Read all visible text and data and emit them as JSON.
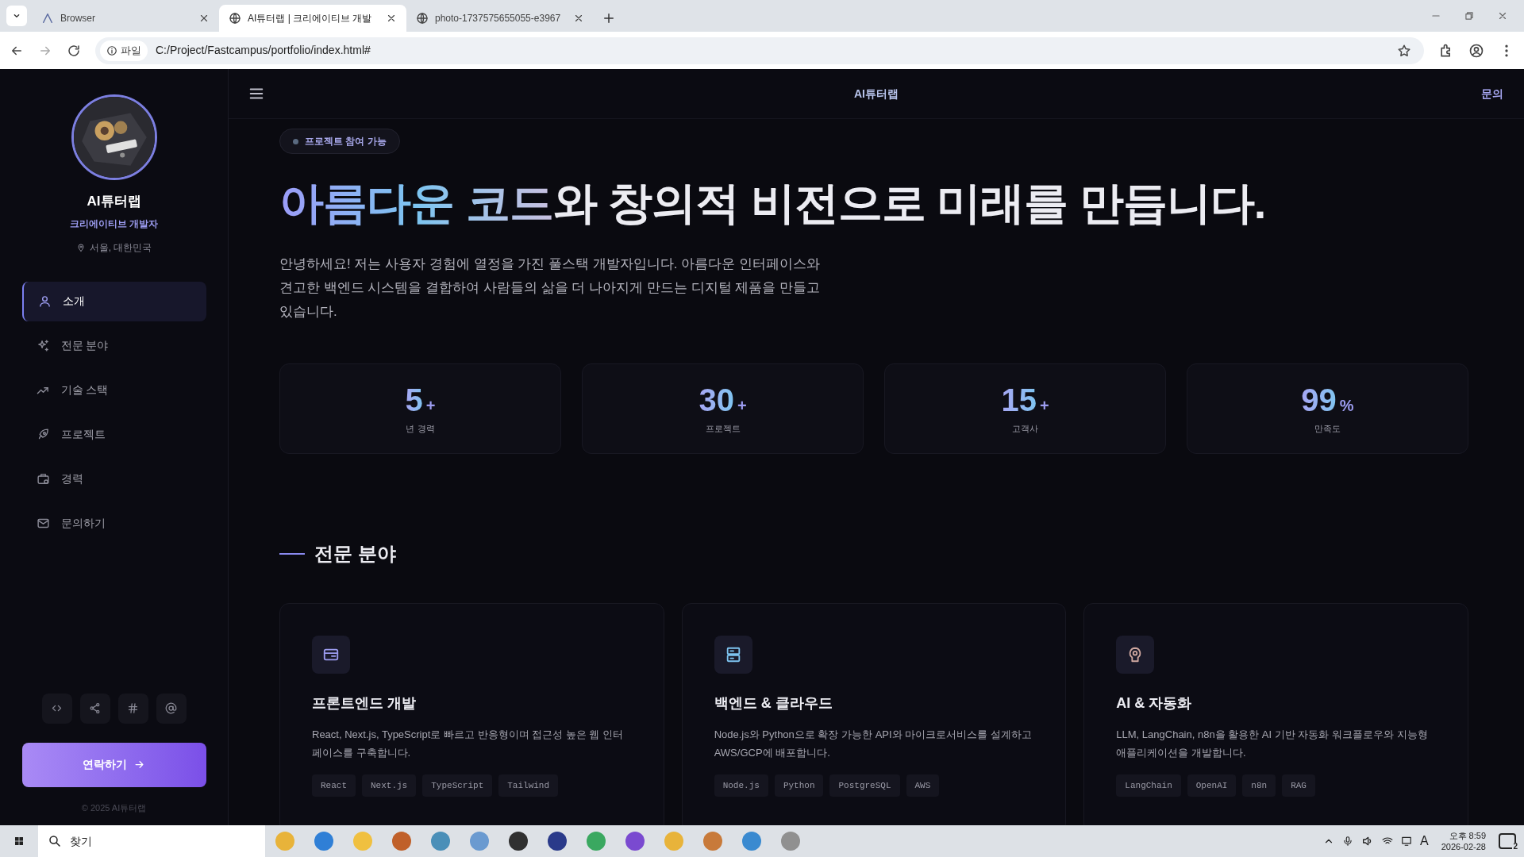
{
  "browser": {
    "tabs": [
      {
        "title": "Browser",
        "selected": false,
        "kind": "app"
      },
      {
        "title": "AI튜터랩 | 크리에이티브 개발",
        "selected": true,
        "kind": "web"
      },
      {
        "title": "photo-1737575655055-e3967",
        "selected": false,
        "kind": "web"
      }
    ],
    "address": {
      "scheme_label": "파일",
      "url": "C:/Project/Fastcampus/portfolio/index.html#"
    }
  },
  "sidebar": {
    "name": "AI튜터랩",
    "role": "크리에이티브 개발자",
    "location": "서울, 대한민국",
    "nav": [
      {
        "label": "소개",
        "selected": true
      },
      {
        "label": "전문 분야",
        "selected": false
      },
      {
        "label": "기술 스택",
        "selected": false
      },
      {
        "label": "프로젝트",
        "selected": false
      },
      {
        "label": "경력",
        "selected": false
      },
      {
        "label": "문의하기",
        "selected": false
      }
    ],
    "contact_button": "연락하기",
    "copyright": "© 2025 AI튜터랩"
  },
  "header": {
    "title": "AI튜터랩",
    "link": "문의"
  },
  "hero": {
    "badge": "프로젝트 참여 가능",
    "title_highlight": "아름다운 코드",
    "title_rest": "와 창의적 비전으로 미래를 만듭니다.",
    "intro": "안녕하세요! 저는 사용자 경험에 열정을 가진 풀스택 개발자입니다. 아름다운 인터페이스와 견고한 백엔드 시스템을 결합하여 사람들의 삶을 더 나아지게 만드는 디지털 제품을 만들고 있습니다."
  },
  "stats": [
    {
      "value": "5",
      "suffix": "+",
      "label": "년 경력"
    },
    {
      "value": "30",
      "suffix": "+",
      "label": "프로젝트"
    },
    {
      "value": "15",
      "suffix": "+",
      "label": "고객사"
    },
    {
      "value": "99",
      "suffix": "%",
      "label": "만족도"
    }
  ],
  "expertise": {
    "title": "전문 분야",
    "cards": [
      {
        "title": "프론트엔드 개발",
        "text": "React, Next.js, TypeScript로 빠르고 반응형이며 접근성 높은 웹 인터페이스를 구축합니다.",
        "tags": [
          "React",
          "Next.js",
          "TypeScript",
          "Tailwind"
        ]
      },
      {
        "title": "백엔드 & 클라우드",
        "text": "Node.js와 Python으로 확장 가능한 API와 마이크로서비스를 설계하고 AWS/GCP에 배포합니다.",
        "tags": [
          "Node.js",
          "Python",
          "PostgreSQL",
          "AWS"
        ]
      },
      {
        "title": "AI & 자동화",
        "text": "LLM, LangChain, n8n을 활용한 AI 기반 자동화 워크플로우와 지능형 애플리케이션을 개발합니다.",
        "tags": [
          "LangChain",
          "OpenAI",
          "n8n",
          "RAG"
        ]
      }
    ]
  },
  "taskbar": {
    "search": "찾기",
    "apps": [
      {
        "color": "#e8b33a"
      },
      {
        "color": "#2f7fd6"
      },
      {
        "color": "#f0c040"
      },
      {
        "color": "#c0602a"
      },
      {
        "color": "#4a8fb8"
      },
      {
        "color": "#6a9ad0"
      },
      {
        "color": "#303030"
      },
      {
        "color": "#2a3a8a"
      },
      {
        "color": "#3aa860"
      },
      {
        "color": "#7a4ad0"
      },
      {
        "color": "#e8b33a"
      },
      {
        "color": "#c87a3a"
      },
      {
        "color": "#3a8ad0"
      },
      {
        "color": "#909090"
      }
    ],
    "ime": "A",
    "time": "오후 8:59",
    "date": "2026-02-28",
    "notifications": "2"
  }
}
